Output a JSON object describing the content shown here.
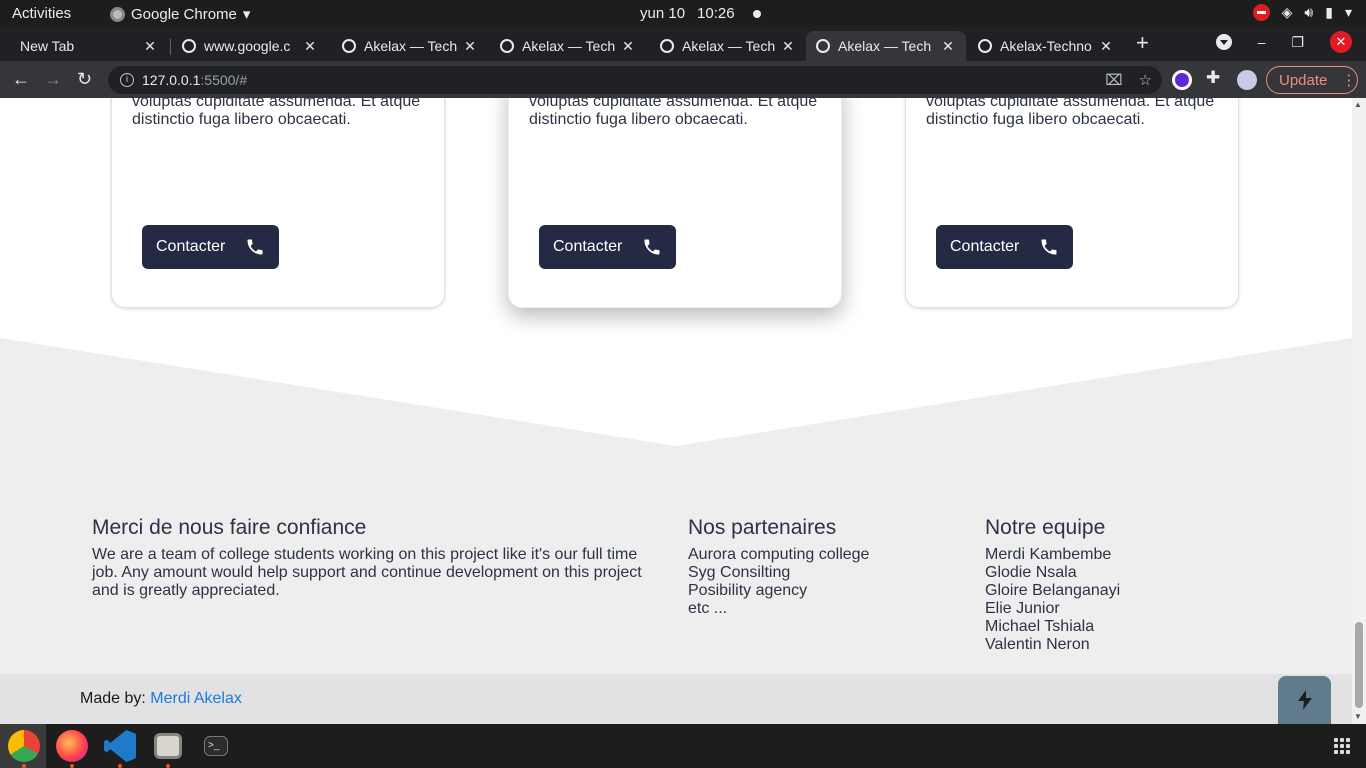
{
  "system": {
    "activities": "Activities",
    "app_name": "Google Chrome",
    "date": "yun 10",
    "time": "10:26"
  },
  "browser": {
    "tabs": [
      {
        "title": "New Tab"
      },
      {
        "title": "www.google.c"
      },
      {
        "title": "Akelax — Tech"
      },
      {
        "title": "Akelax — Tech"
      },
      {
        "title": "Akelax — Tech"
      },
      {
        "title": "Akelax — Tech"
      },
      {
        "title": "Akelax-Techno"
      }
    ],
    "address": {
      "host": "127.0.0.1",
      "rest": ":5500/#"
    },
    "update_label": "Update"
  },
  "cards": [
    {
      "text": "voluptas cupiditate assumenda. Et atque distinctio fuga libero obcaecati.",
      "button": "Contacter"
    },
    {
      "text": "adipisicing elit. Voluptatem libero incidunt voluptas cupiditate assumenda. Et atque distinctio fuga libero obcaecati.",
      "button": "Contacter"
    },
    {
      "text": "adipisicing elit. Voluptatem libero incidunt voluptas cupiditate assumenda. Et atque distinctio fuga libero obcaecati.",
      "button": "Contacter"
    }
  ],
  "footer": {
    "about": {
      "title": "Merci de nous faire confiance",
      "text": "We are a team of college students working on this project like it's our full time job. Any amount would help support and continue development on this project and is greatly appreciated."
    },
    "partners": {
      "title": "Nos partenaires",
      "items": [
        "Aurora computing college",
        "Syg Consilting",
        "Posibility agency",
        "etc ..."
      ]
    },
    "team": {
      "title": "Notre equipe",
      "items": [
        "Merdi Kambembe",
        "Glodie Nsala",
        "Gloire Belanganayi",
        "Elie Junior",
        "Michael Tshiala",
        "Valentin Neron"
      ]
    },
    "madeby_label": "Made by:",
    "madeby_link": "Merdi Akelax"
  },
  "colors": {
    "button_bg": "#242a44",
    "footer_bg": "#eeeeee",
    "madeby_bg": "#e2e2e4",
    "link": "#1a7be0",
    "fab_bg": "#607b8b"
  }
}
